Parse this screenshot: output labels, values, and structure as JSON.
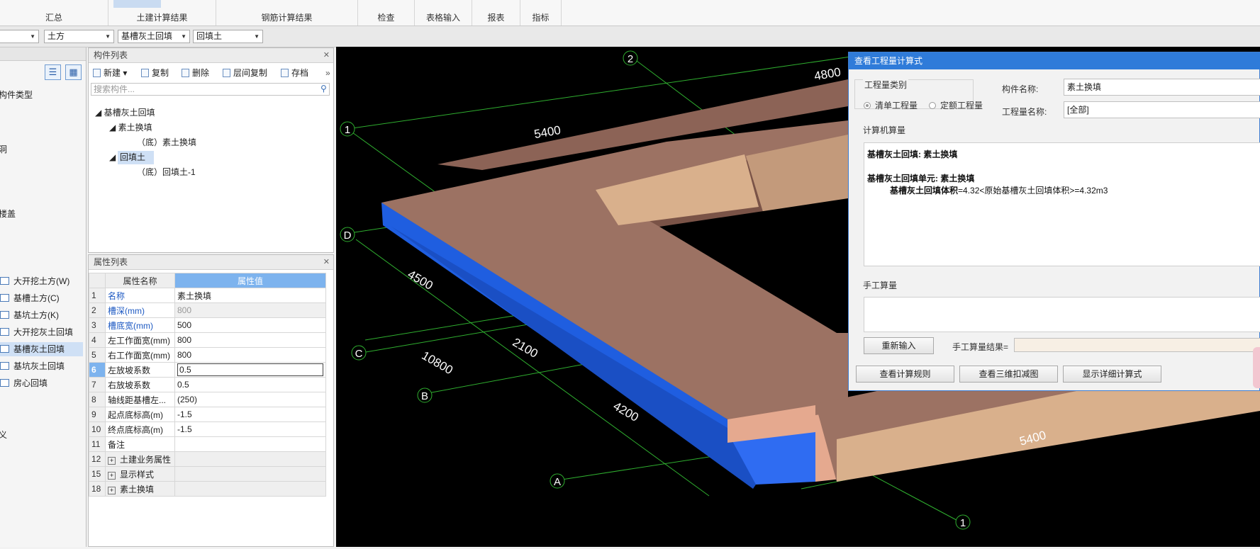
{
  "ribbon": {
    "tabs": [
      "汇总",
      "土建计算结果",
      "钢筋计算结果",
      "检查",
      "表格输入",
      "报表",
      "指标"
    ]
  },
  "filterbar": {
    "combo1": "",
    "combo2": "土方",
    "combo3": "基槽灰土回填",
    "combo4": "回填土"
  },
  "leftnav": {
    "items": [
      "构件类型",
      "",
      "",
      "洞",
      "",
      "楼盖",
      "",
      "",
      ""
    ],
    "earth_items": [
      "大开挖土方(W)",
      "基槽土方(C)",
      "基坑土方(K)",
      "大开挖灰土回填",
      "基槽灰土回填",
      "基坑灰土回填",
      "房心回填"
    ],
    "tail_items": [
      "",
      "",
      "义"
    ]
  },
  "component_list": {
    "title": "构件列表",
    "toolbar": {
      "new": "新建",
      "copy": "复制",
      "delete": "删除",
      "floor_copy": "层间复制",
      "save": "存档"
    },
    "search_placeholder": "搜索构件...",
    "tree": {
      "root": "基槽灰土回填",
      "g1": "素土换填",
      "g1_child": "（底）素土换填",
      "g2": "回填土",
      "g2_child": "（底）回填土-1"
    }
  },
  "property_list": {
    "title": "属性列表",
    "col_name": "属性名称",
    "col_value": "属性值",
    "rows": [
      {
        "no": "1",
        "name": "名称",
        "value": "素土换填"
      },
      {
        "no": "2",
        "name": "槽深(mm)",
        "value": "800"
      },
      {
        "no": "3",
        "name": "槽底宽(mm)",
        "value": "500"
      },
      {
        "no": "4",
        "name": "左工作面宽(mm)",
        "value": "800"
      },
      {
        "no": "5",
        "name": "右工作面宽(mm)",
        "value": "800"
      },
      {
        "no": "6",
        "name": "左放坡系数",
        "value": "0.5"
      },
      {
        "no": "7",
        "name": "右放坡系数",
        "value": "0.5"
      },
      {
        "no": "8",
        "name": "轴线距基槽左...",
        "value": "(250)"
      },
      {
        "no": "9",
        "name": "起点底标高(m)",
        "value": "-1.5"
      },
      {
        "no": "10",
        "name": "终点底标高(m)",
        "value": "-1.5"
      },
      {
        "no": "11",
        "name": "备注",
        "value": ""
      },
      {
        "no": "12",
        "name": "土建业务属性",
        "value": ""
      },
      {
        "no": "15",
        "name": "显示样式",
        "value": ""
      },
      {
        "no": "18",
        "name": "素土换填",
        "value": ""
      }
    ]
  },
  "viewport": {
    "axis_labels": [
      "2",
      "1",
      "D",
      "C",
      "B",
      "A",
      "1"
    ],
    "dimensions": [
      "4800",
      "5400",
      "4500",
      "2100",
      "10800",
      "4200",
      "5400"
    ]
  },
  "dialog": {
    "title": "查看工程量计算式",
    "qty_type_label": "工程量类别",
    "radio_list": "清单工程量",
    "radio_quota": "定额工程量",
    "comp_name_label": "构件名称:",
    "comp_name_value": "素土换填",
    "qty_name_label": "工程量名称:",
    "qty_name_value": "[全部]",
    "computer_calc_label": "计算机算量",
    "calc_line1": "基槽灰土回填: 素土换填",
    "calc_line2": "基槽灰土回填单元: 素土换填",
    "calc_line3_bold": "基槽灰土回填体积",
    "calc_line3_rest": "=4.32<原始基槽灰土回填体积>=4.32m3",
    "manual_calc_label": "手工算量",
    "reinput_button": "重新输入",
    "manual_result_label": "手工算量结果=",
    "btn_rules": "查看计算规则",
    "btn_3d": "查看三维扣减图",
    "btn_detail": "显示详细计算式"
  },
  "colors": {
    "accent": "#2f7bd9",
    "selection": "#cfe0f5",
    "header_blue": "#7db3ee",
    "soil_top": "#9c7263",
    "soil_light": "#d9b08c",
    "trench_blue": "#1f5ee0"
  }
}
